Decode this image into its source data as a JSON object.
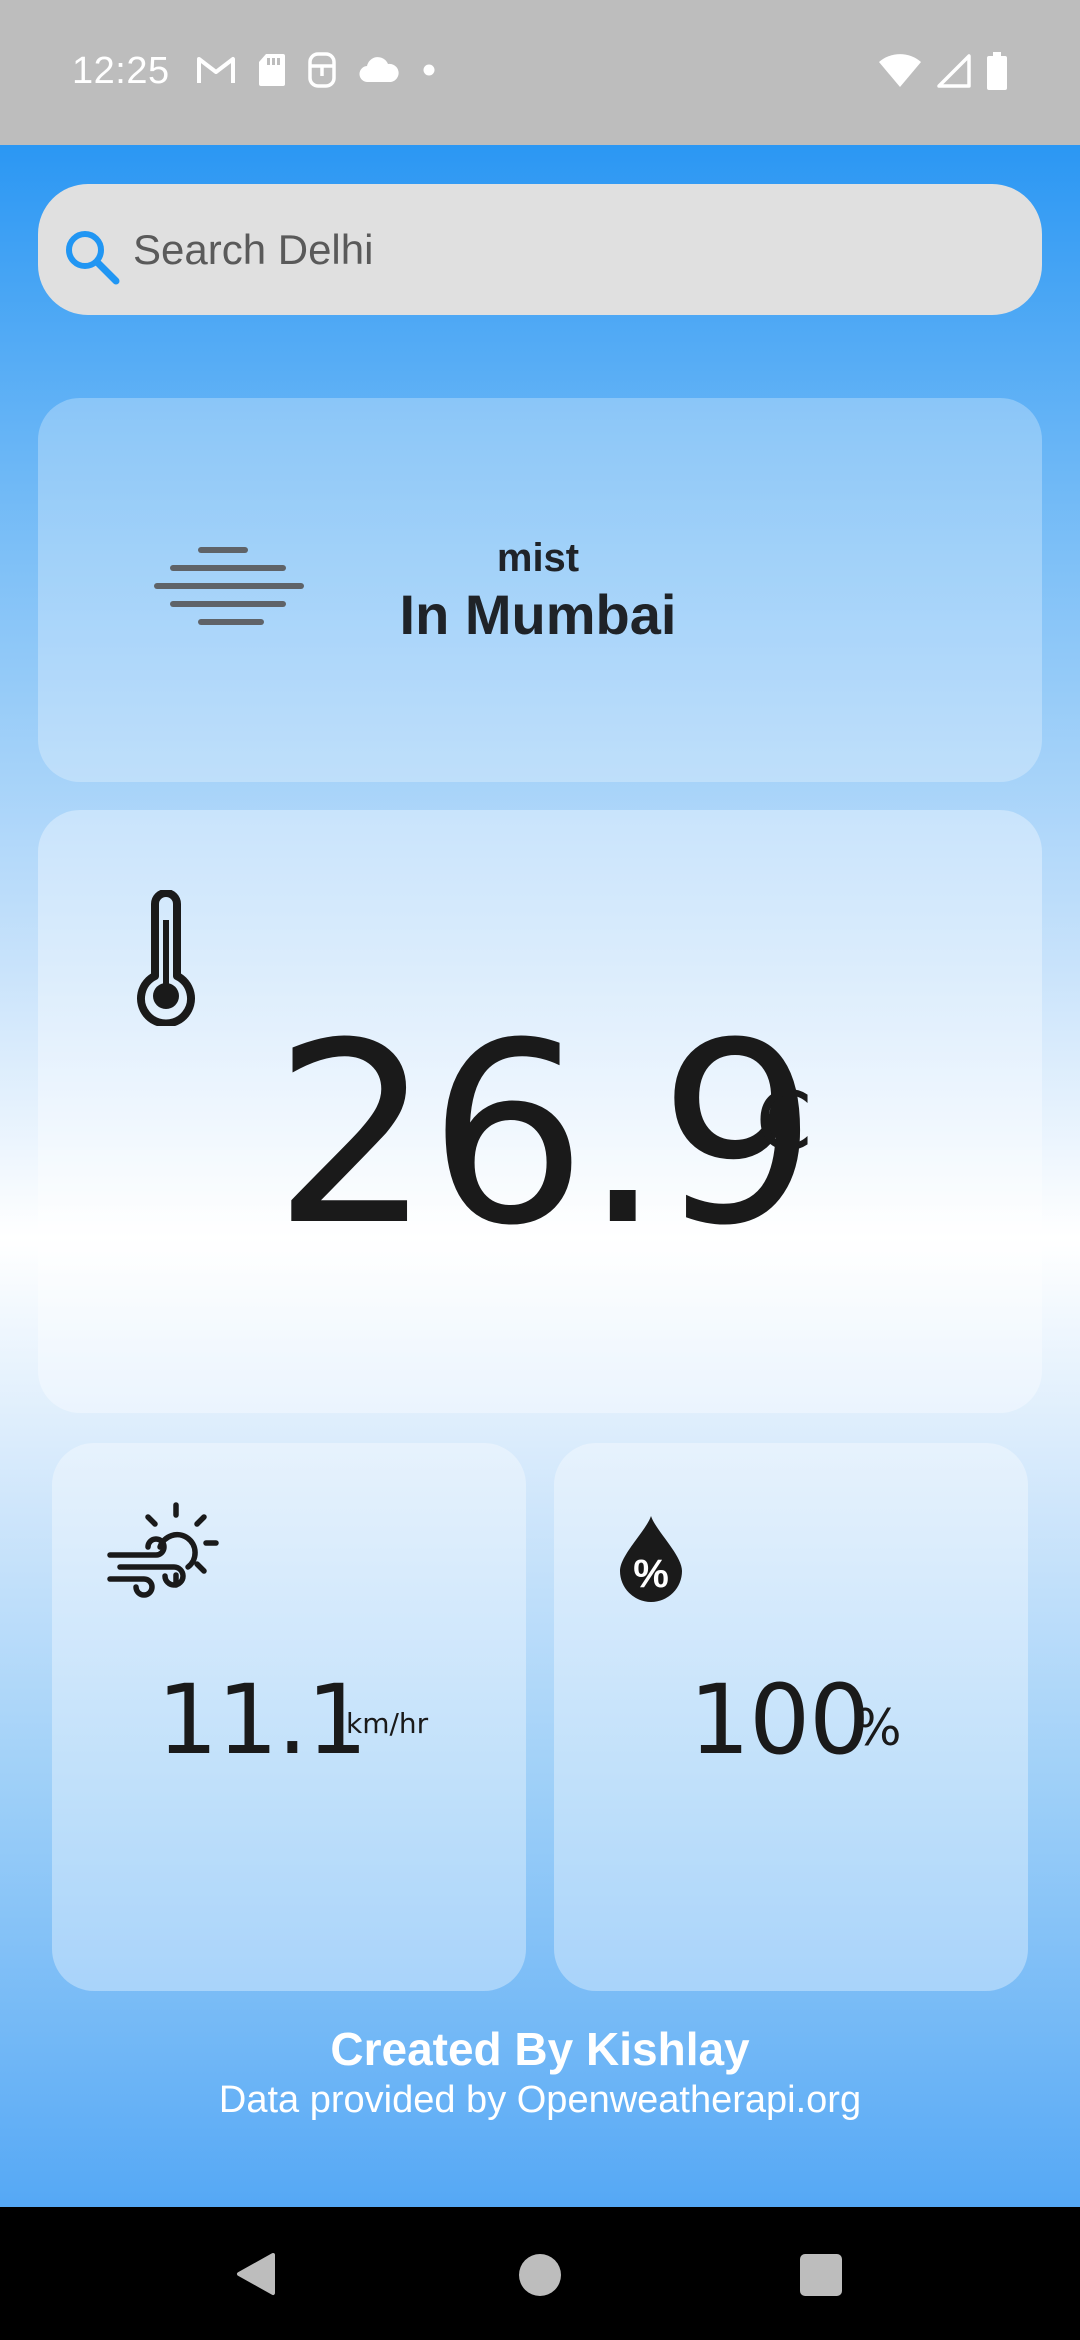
{
  "status_bar": {
    "time": "12:25",
    "left_icons": [
      "gmail-icon",
      "sd-card-icon",
      "security-icon",
      "cloud-icon",
      "dot-icon"
    ],
    "right_icons": [
      "wifi-icon",
      "cell-signal-icon",
      "battery-icon"
    ]
  },
  "search": {
    "placeholder": "Search Delhi",
    "value": ""
  },
  "condition": {
    "description": "mist",
    "location": "In Mumbai",
    "icon": "mist-icon"
  },
  "temperature": {
    "value": "26.9",
    "unit": "C",
    "icon": "thermometer-icon"
  },
  "wind": {
    "value": "11.1",
    "unit": "km/hr",
    "icon": "wind-sun-icon"
  },
  "humidity": {
    "value": "100",
    "unit": "%",
    "icon": "humidity-drop-icon"
  },
  "footer": {
    "credit": "Created By Kishlay",
    "source": "Data provided by Openweatherapi.org"
  },
  "colors": {
    "accent": "#2196f3",
    "text_dark": "#1f2328",
    "search_bg": "#e0e0e0",
    "status_bar_bg": "#bdbdbd"
  }
}
